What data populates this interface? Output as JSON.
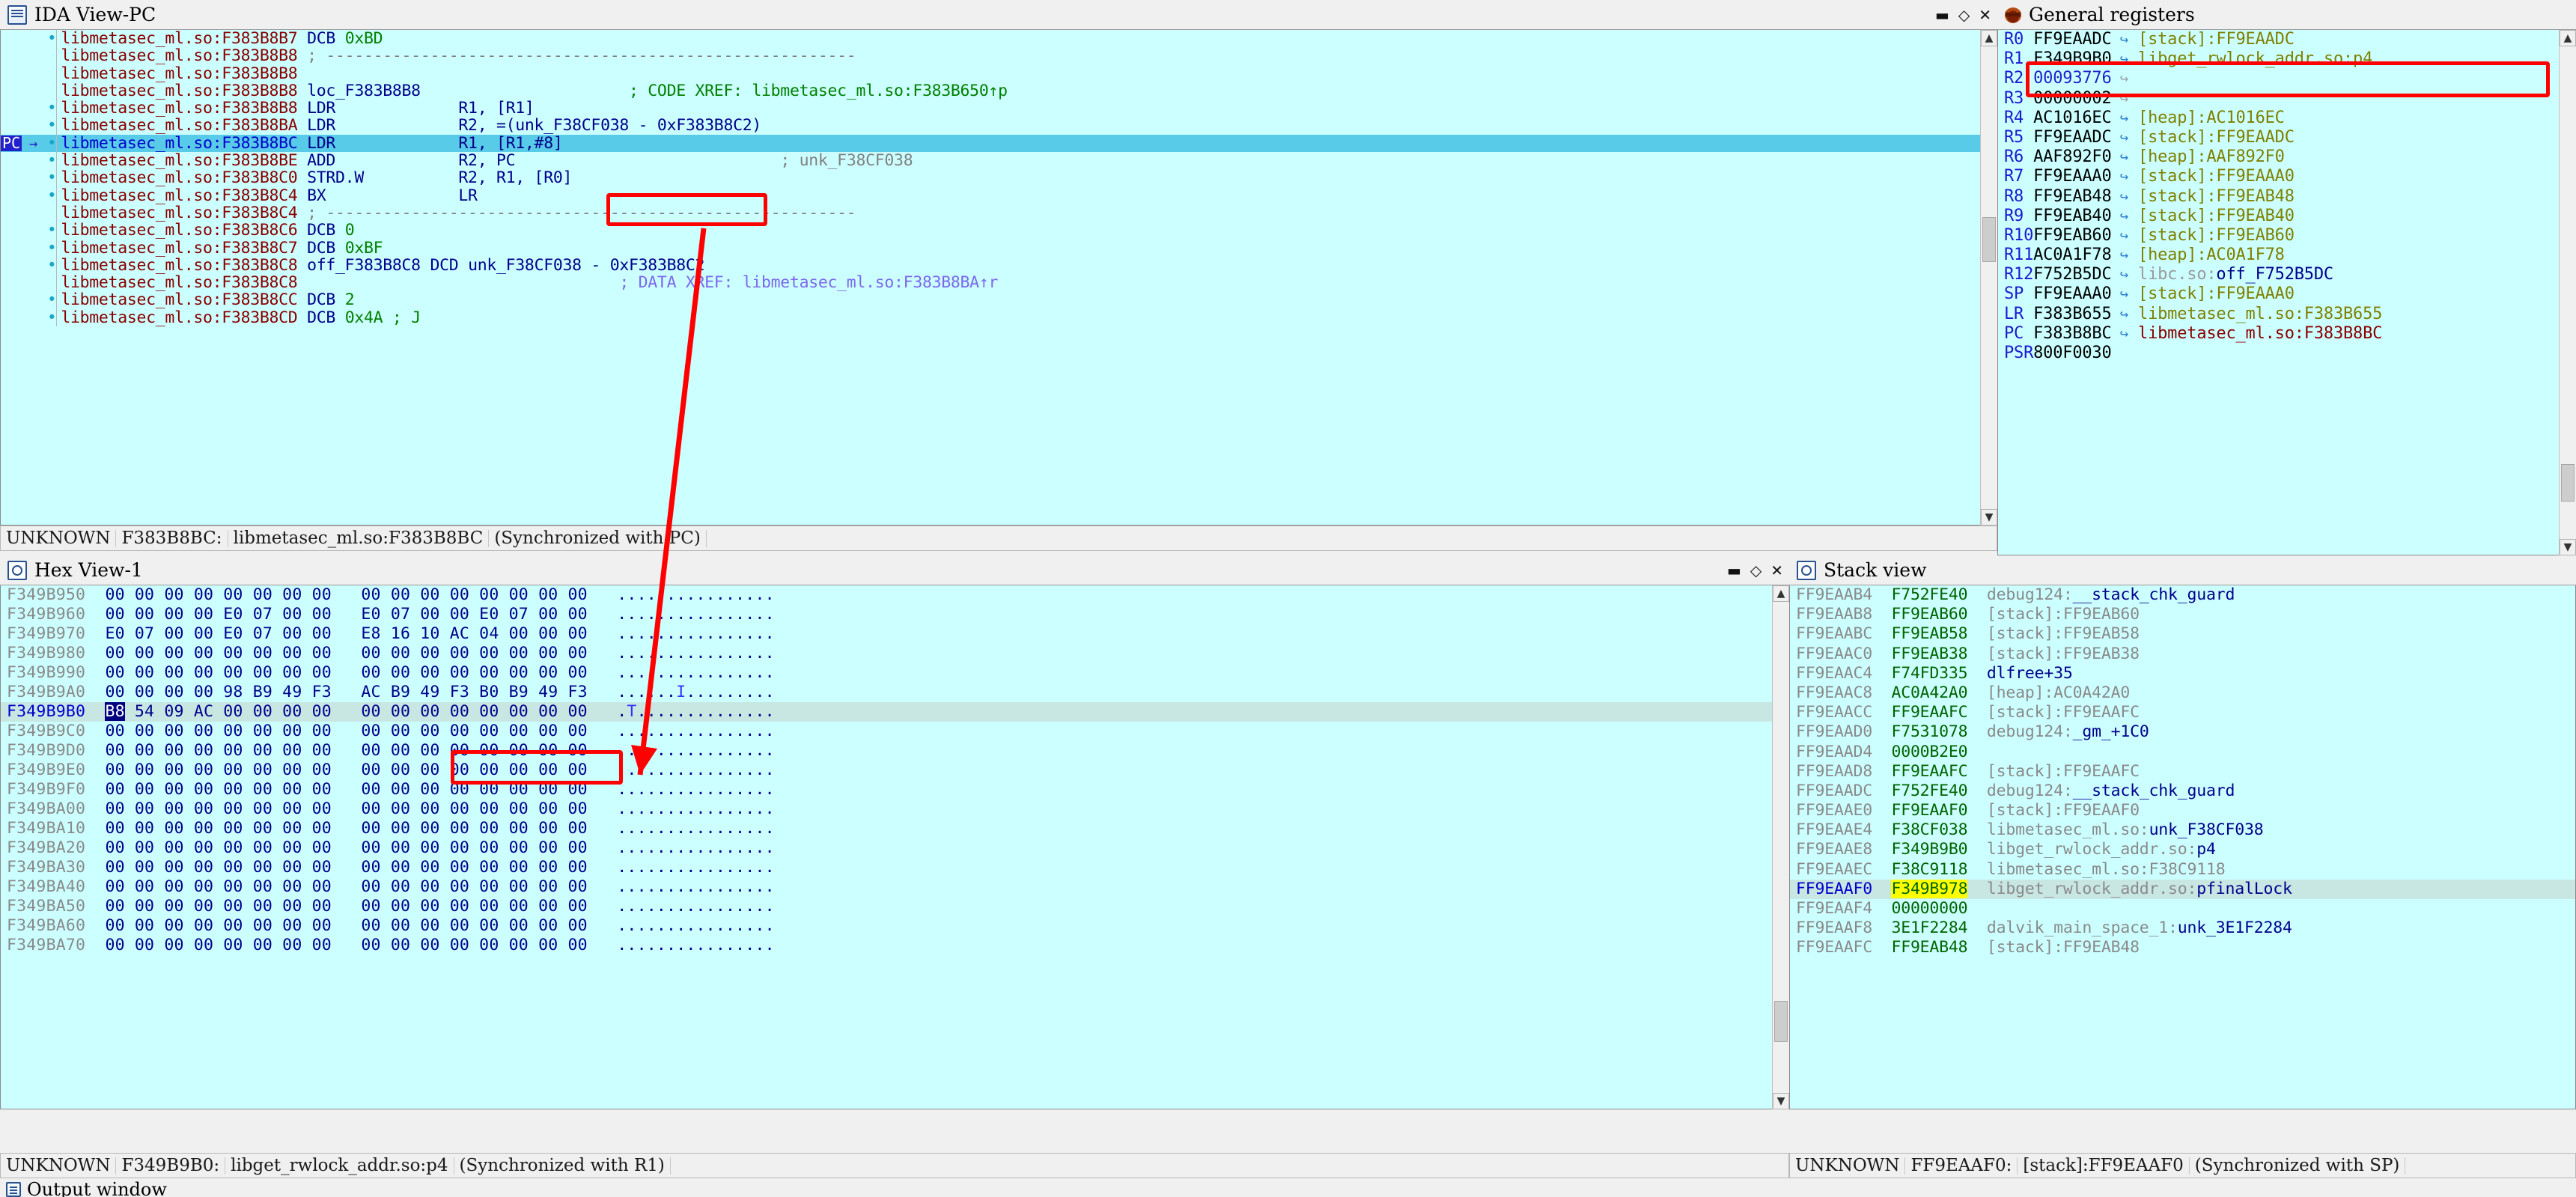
{
  "colors": {
    "panel_bg": "#ccffff",
    "chrome": "#f0f0f0",
    "current_line": "#58cbe8",
    "annotation": "#ff0000",
    "highlight_yellow": "#ffff00",
    "selection_row": "#c8e6e2"
  },
  "disasm": {
    "title": "IDA View-PC",
    "icon": "document-icon",
    "window_buttons": [
      "minimize",
      "maximize",
      "close"
    ],
    "pc_badge": "PC",
    "status": {
      "type": "UNKNOWN",
      "address": "F383B8BC:",
      "location": "libmetasec_ml.so:F383B8BC",
      "sync": "(Synchronized with PC)"
    },
    "rows": [
      {
        "bp": true,
        "addr": "libmetasec_ml.so:F383B8B7",
        "name": "",
        "mnem": "DCB",
        "ops": "0xBD",
        "cmt": "",
        "kind": "dcb"
      },
      {
        "bp": false,
        "addr": "libmetasec_ml.so:F383B8B8",
        "name": "",
        "mnem": "",
        "ops": "",
        "cmt": "",
        "kind": "divider"
      },
      {
        "bp": false,
        "addr": "libmetasec_ml.so:F383B8B8",
        "name": "",
        "mnem": "",
        "ops": "",
        "cmt": "",
        "kind": "blank"
      },
      {
        "bp": false,
        "addr": "libmetasec_ml.so:F383B8B8",
        "name": "loc_F383B8B8",
        "mnem": "",
        "ops": "",
        "cmt": "; CODE XREF: libmetasec_ml.so:F383B650↑p",
        "kind": "label"
      },
      {
        "bp": true,
        "addr": "libmetasec_ml.so:F383B8B8",
        "name": "",
        "mnem": "LDR",
        "ops": "R1, [R1]",
        "cmt": "",
        "kind": "insn"
      },
      {
        "bp": true,
        "addr": "libmetasec_ml.so:F383B8BA",
        "name": "",
        "mnem": "LDR",
        "ops": "R2, =(unk_F38CF038 - 0xF383B8C2)",
        "cmt": "",
        "kind": "insn"
      },
      {
        "bp": true,
        "addr": "libmetasec_ml.so:F383B8BC",
        "name": "",
        "mnem": "LDR",
        "ops": "R1, [R1,#8]",
        "cmt": "",
        "kind": "insn",
        "current": true
      },
      {
        "bp": true,
        "addr": "libmetasec_ml.so:F383B8BE",
        "name": "",
        "mnem": "ADD",
        "ops": "R2, PC",
        "cmt": "; unk_F38CF038",
        "kind": "insn"
      },
      {
        "bp": true,
        "addr": "libmetasec_ml.so:F383B8C0",
        "name": "",
        "mnem": "STRD.W",
        "ops": "R2, R1, [R0]",
        "cmt": "",
        "kind": "insn"
      },
      {
        "bp": true,
        "addr": "libmetasec_ml.so:F383B8C4",
        "name": "",
        "mnem": "BX",
        "ops": "LR",
        "cmt": "",
        "kind": "insn"
      },
      {
        "bp": false,
        "addr": "libmetasec_ml.so:F383B8C4",
        "name": "",
        "mnem": "",
        "ops": "",
        "cmt": "",
        "kind": "divider"
      },
      {
        "bp": true,
        "addr": "libmetasec_ml.so:F383B8C6",
        "name": "",
        "mnem": "DCB",
        "ops": "0",
        "cmt": "",
        "kind": "dcb"
      },
      {
        "bp": true,
        "addr": "libmetasec_ml.so:F383B8C7",
        "name": "",
        "mnem": "DCB",
        "ops": "0xBF",
        "cmt": "",
        "kind": "dcb"
      },
      {
        "bp": true,
        "addr": "libmetasec_ml.so:F383B8C8",
        "name": "off_F383B8C8",
        "mnem": "DCD",
        "ops": "unk_F38CF038 - 0xF383B8C2",
        "cmt": "",
        "kind": "dcd"
      },
      {
        "bp": false,
        "addr": "libmetasec_ml.so:F383B8C8",
        "name": "",
        "mnem": "",
        "ops": "",
        "cmt": "; DATA XREF: libmetasec_ml.so:F383B8BA↑r",
        "kind": "dataxref"
      },
      {
        "bp": true,
        "addr": "libmetasec_ml.so:F383B8CC",
        "name": "",
        "mnem": "DCB",
        "ops": "2",
        "cmt": "",
        "kind": "dcb"
      },
      {
        "bp": true,
        "addr": "libmetasec_ml.so:F383B8CD",
        "name": "",
        "mnem": "DCB",
        "ops": "0x4A ; J",
        "cmt": "",
        "kind": "dcb"
      }
    ]
  },
  "registers": {
    "title": "General registers",
    "icon": "bug-icon",
    "rows": [
      {
        "name": "R0",
        "value": "FF9EAADC",
        "arrow": true,
        "target": "[stack]:FF9EAADC",
        "target_kind": "stack"
      },
      {
        "name": "R1",
        "value": "F349B9B0",
        "arrow": true,
        "target": "libget_rwlock_addr.so:p4",
        "target_kind": "stack",
        "annotated": true
      },
      {
        "name": "R2",
        "value": "00093776",
        "arrow": true,
        "target": "",
        "target_kind": "none",
        "value_kind": "num",
        "arrow_grey": true
      },
      {
        "name": "R3",
        "value": "00000002",
        "arrow": true,
        "target": "",
        "target_kind": "none",
        "arrow_grey": true
      },
      {
        "name": "R4",
        "value": "AC1016EC",
        "arrow": true,
        "target": "[heap]:AC1016EC",
        "target_kind": "stack"
      },
      {
        "name": "R5",
        "value": "FF9EAADC",
        "arrow": true,
        "target": "[stack]:FF9EAADC",
        "target_kind": "stack"
      },
      {
        "name": "R6",
        "value": "AAF892F0",
        "arrow": true,
        "target": "[heap]:AAF892F0",
        "target_kind": "stack"
      },
      {
        "name": "R7",
        "value": "FF9EAAA0",
        "arrow": true,
        "target": "[stack]:FF9EAAA0",
        "target_kind": "stack"
      },
      {
        "name": "R8",
        "value": "FF9EAB48",
        "arrow": true,
        "target": "[stack]:FF9EAB48",
        "target_kind": "stack"
      },
      {
        "name": "R9",
        "value": "FF9EAB40",
        "arrow": true,
        "target": "[stack]:FF9EAB40",
        "target_kind": "stack"
      },
      {
        "name": "R10",
        "value": "FF9EAB60",
        "arrow": true,
        "target": "[stack]:FF9EAB60",
        "target_kind": "stack"
      },
      {
        "name": "R11",
        "value": "AC0A1F78",
        "arrow": true,
        "target": "[heap]:AC0A1F78",
        "target_kind": "stack"
      },
      {
        "name": "R12",
        "value": "F752B5DC",
        "arrow": true,
        "target": "libc.so:off_F752B5DC",
        "target_kind": "split_grey_blue",
        "split_at": 8
      },
      {
        "name": "SP",
        "value": "FF9EAAA0",
        "arrow": true,
        "target": "[stack]:FF9EAAA0",
        "target_kind": "stack"
      },
      {
        "name": "LR",
        "value": "F383B655",
        "arrow": true,
        "target": "libmetasec_ml.so:F383B655",
        "target_kind": "stack"
      },
      {
        "name": "PC",
        "value": "F383B8BC",
        "arrow": true,
        "target": "libmetasec_ml.so:F383B8BC",
        "target_kind": "red"
      },
      {
        "name": "PSR",
        "value": "800F0030",
        "arrow": false,
        "target": "",
        "target_kind": "none"
      }
    ]
  },
  "hexview": {
    "title": "Hex View-1",
    "icon": "hex-icon",
    "window_buttons": [
      "minimize",
      "maximize",
      "close"
    ],
    "status": {
      "type": "UNKNOWN",
      "address": "F349B9B0:",
      "location": "libget_rwlock_addr.so:p4",
      "sync": "(Synchronized with R1)"
    },
    "rows": [
      {
        "addr": "F349B950",
        "bytes": [
          "00",
          "00",
          "00",
          "00",
          "00",
          "00",
          "00",
          "00",
          "00",
          "00",
          "00",
          "00",
          "00",
          "00",
          "00",
          "00"
        ],
        "ascii": "................"
      },
      {
        "addr": "F349B960",
        "bytes": [
          "00",
          "00",
          "00",
          "00",
          "E0",
          "07",
          "00",
          "00",
          "E0",
          "07",
          "00",
          "00",
          "E0",
          "07",
          "00",
          "00"
        ],
        "ascii": "................"
      },
      {
        "addr": "F349B970",
        "bytes": [
          "E0",
          "07",
          "00",
          "00",
          "E0",
          "07",
          "00",
          "00",
          "E8",
          "16",
          "10",
          "AC",
          "04",
          "00",
          "00",
          "00"
        ],
        "ascii": "................"
      },
      {
        "addr": "F349B980",
        "bytes": [
          "00",
          "00",
          "00",
          "00",
          "00",
          "00",
          "00",
          "00",
          "00",
          "00",
          "00",
          "00",
          "00",
          "00",
          "00",
          "00"
        ],
        "ascii": "................"
      },
      {
        "addr": "F349B990",
        "bytes": [
          "00",
          "00",
          "00",
          "00",
          "00",
          "00",
          "00",
          "00",
          "00",
          "00",
          "00",
          "00",
          "00",
          "00",
          "00",
          "00"
        ],
        "ascii": "................"
      },
      {
        "addr": "F349B9A0",
        "bytes": [
          "00",
          "00",
          "00",
          "00",
          "98",
          "B9",
          "49",
          "F3",
          "AC",
          "B9",
          "49",
          "F3",
          "B0",
          "B9",
          "49",
          "F3"
        ],
        "ascii": "......I........."
      },
      {
        "addr": "F349B9B0",
        "bytes": [
          "B8",
          "54",
          "09",
          "AC",
          "00",
          "00",
          "00",
          "00",
          "00",
          "00",
          "00",
          "00",
          "00",
          "00",
          "00",
          "00"
        ],
        "ascii": ".T..............",
        "current": true,
        "sel_index": 0,
        "annot_from": 8,
        "annot_to": 11
      },
      {
        "addr": "F349B9C0",
        "bytes": [
          "00",
          "00",
          "00",
          "00",
          "00",
          "00",
          "00",
          "00",
          "00",
          "00",
          "00",
          "00",
          "00",
          "00",
          "00",
          "00"
        ],
        "ascii": "................"
      },
      {
        "addr": "F349B9D0",
        "bytes": [
          "00",
          "00",
          "00",
          "00",
          "00",
          "00",
          "00",
          "00",
          "00",
          "00",
          "00",
          "00",
          "00",
          "00",
          "00",
          "00"
        ],
        "ascii": "................"
      },
      {
        "addr": "F349B9E0",
        "bytes": [
          "00",
          "00",
          "00",
          "00",
          "00",
          "00",
          "00",
          "00",
          "00",
          "00",
          "00",
          "00",
          "00",
          "00",
          "00",
          "00"
        ],
        "ascii": "................"
      },
      {
        "addr": "F349B9F0",
        "bytes": [
          "00",
          "00",
          "00",
          "00",
          "00",
          "00",
          "00",
          "00",
          "00",
          "00",
          "00",
          "00",
          "00",
          "00",
          "00",
          "00"
        ],
        "ascii": "................"
      },
      {
        "addr": "F349BA00",
        "bytes": [
          "00",
          "00",
          "00",
          "00",
          "00",
          "00",
          "00",
          "00",
          "00",
          "00",
          "00",
          "00",
          "00",
          "00",
          "00",
          "00"
        ],
        "ascii": "................"
      },
      {
        "addr": "F349BA10",
        "bytes": [
          "00",
          "00",
          "00",
          "00",
          "00",
          "00",
          "00",
          "00",
          "00",
          "00",
          "00",
          "00",
          "00",
          "00",
          "00",
          "00"
        ],
        "ascii": "................"
      },
      {
        "addr": "F349BA20",
        "bytes": [
          "00",
          "00",
          "00",
          "00",
          "00",
          "00",
          "00",
          "00",
          "00",
          "00",
          "00",
          "00",
          "00",
          "00",
          "00",
          "00"
        ],
        "ascii": "................"
      },
      {
        "addr": "F349BA30",
        "bytes": [
          "00",
          "00",
          "00",
          "00",
          "00",
          "00",
          "00",
          "00",
          "00",
          "00",
          "00",
          "00",
          "00",
          "00",
          "00",
          "00"
        ],
        "ascii": "................"
      },
      {
        "addr": "F349BA40",
        "bytes": [
          "00",
          "00",
          "00",
          "00",
          "00",
          "00",
          "00",
          "00",
          "00",
          "00",
          "00",
          "00",
          "00",
          "00",
          "00",
          "00"
        ],
        "ascii": "................"
      },
      {
        "addr": "F349BA50",
        "bytes": [
          "00",
          "00",
          "00",
          "00",
          "00",
          "00",
          "00",
          "00",
          "00",
          "00",
          "00",
          "00",
          "00",
          "00",
          "00",
          "00"
        ],
        "ascii": "................"
      },
      {
        "addr": "F349BA60",
        "bytes": [
          "00",
          "00",
          "00",
          "00",
          "00",
          "00",
          "00",
          "00",
          "00",
          "00",
          "00",
          "00",
          "00",
          "00",
          "00",
          "00"
        ],
        "ascii": "................"
      },
      {
        "addr": "F349BA70",
        "bytes": [
          "00",
          "00",
          "00",
          "00",
          "00",
          "00",
          "00",
          "00",
          "00",
          "00",
          "00",
          "00",
          "00",
          "00",
          "00",
          "00"
        ],
        "ascii": "................"
      }
    ]
  },
  "stackview": {
    "title": "Stack view",
    "icon": "hex-icon",
    "status": {
      "type": "UNKNOWN",
      "address": "FF9EAAF0:",
      "location": "[stack]:FF9EAAF0",
      "sync": "(Synchronized with SP)"
    },
    "rows": [
      {
        "addr": "FF9EAAB4",
        "value": "F752FE40",
        "desc": "debug124:",
        "sym": "__stack_chk_guard"
      },
      {
        "addr": "FF9EAAB8",
        "value": "FF9EAB60",
        "desc": "[stack]:FF9EAB60",
        "sym": ""
      },
      {
        "addr": "FF9EAABC",
        "value": "FF9EAB58",
        "desc": "[stack]:FF9EAB58",
        "sym": ""
      },
      {
        "addr": "FF9EAAC0",
        "value": "FF9EAB38",
        "desc": "[stack]:FF9EAB38",
        "sym": ""
      },
      {
        "addr": "FF9EAAC4",
        "value": "F74FD335",
        "desc": "",
        "sym": "dlfree+35"
      },
      {
        "addr": "FF9EAAC8",
        "value": "AC0A42A0",
        "desc": "[heap]:AC0A42A0",
        "sym": ""
      },
      {
        "addr": "FF9EAACC",
        "value": "FF9EAAFC",
        "desc": "[stack]:FF9EAAFC",
        "sym": ""
      },
      {
        "addr": "FF9EAAD0",
        "value": "F7531078",
        "desc": "debug124:",
        "sym": "_gm_+1C0"
      },
      {
        "addr": "FF9EAAD4",
        "value": "0000B2E0",
        "desc": "",
        "sym": ""
      },
      {
        "addr": "FF9EAAD8",
        "value": "FF9EAAFC",
        "desc": "[stack]:FF9EAAFC",
        "sym": ""
      },
      {
        "addr": "FF9EAADC",
        "value": "F752FE40",
        "desc": "debug124:",
        "sym": "__stack_chk_guard"
      },
      {
        "addr": "FF9EAAE0",
        "value": "FF9EAAF0",
        "desc": "[stack]:FF9EAAF0",
        "sym": ""
      },
      {
        "addr": "FF9EAAE4",
        "value": "F38CF038",
        "desc": "libmetasec_ml.so:",
        "sym": "unk_F38CF038"
      },
      {
        "addr": "FF9EAAE8",
        "value": "F349B9B0",
        "desc": "libget_rwlock_addr.so:",
        "sym": "p4"
      },
      {
        "addr": "FF9EAAEC",
        "value": "F38C9118",
        "desc": "libmetasec_ml.so:F38C9118",
        "sym": ""
      },
      {
        "addr": "FF9EAAF0",
        "value": "F349B978",
        "desc": "libget_rwlock_addr.so:",
        "sym": "pfinalLock",
        "current": true,
        "value_highlight": true,
        "caret_after": 7
      },
      {
        "addr": "FF9EAAF4",
        "value": "00000000",
        "desc": "",
        "sym": ""
      },
      {
        "addr": "FF9EAAF8",
        "value": "3E1F2284",
        "desc": "dalvik_main_space_1:",
        "sym": "unk_3E1F2284"
      },
      {
        "addr": "FF9EAAFC",
        "value": "FF9EAB48",
        "desc": "[stack]:FF9EAB48",
        "sym": ""
      }
    ]
  },
  "output": {
    "title": "Output window",
    "icon": "document-icon"
  }
}
